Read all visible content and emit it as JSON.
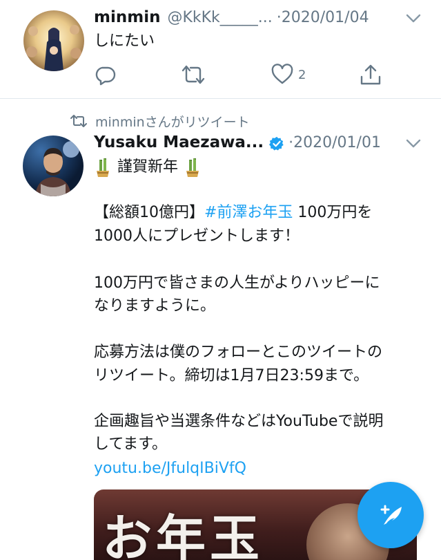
{
  "tweets": [
    {
      "name": "minmin",
      "handle": "@KkKk_____...",
      "date": "·2020/01/04",
      "text": "しにたい",
      "like_count": "2",
      "avatar": "virgin-mary-painting"
    },
    {
      "retweet_context": "minminさんがリツイート",
      "name": "Yusaku Maezawa...",
      "verified": true,
      "date": "·2020/01/01",
      "avatar": "man-portrait",
      "lines": {
        "l1_pre": "謹賀新年",
        "l2_a": "【総額10億円】",
        "l2_hashtag": "#前澤お年玉",
        "l2_b": " 100万円を",
        "l3": "1000人にプレゼントします！",
        "l4": "100万円で皆さまの人生がよりハッピーに",
        "l5": "なりますように。",
        "l6": "応募方法は僕のフォローとこのツイートの",
        "l7": "リツイート。締切は1月7日23:59まで。",
        "l8": "企画趣旨や当選条件などはYouTubeで説明",
        "l9": "してます。",
        "link": "youtu.be/JfulqIBiVfQ"
      },
      "media_title": "お年玉"
    }
  ],
  "colors": {
    "accent": "#1da1f2",
    "secondary_text": "#657786",
    "primary_text": "#14171a",
    "divider": "#e1e8ed"
  },
  "icons": {
    "reply": "reply-icon",
    "retweet": "retweet-icon",
    "like": "heart-icon",
    "share": "share-icon",
    "more": "chevron-down-icon",
    "verified": "verified-badge-icon",
    "kadomatsu": "kadomatsu-icon",
    "compose": "compose-tweet-icon"
  }
}
